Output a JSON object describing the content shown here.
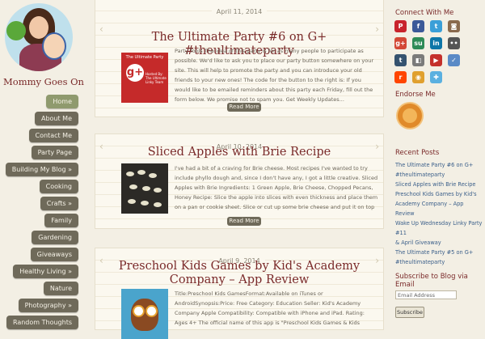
{
  "site": {
    "title": "Mommy Goes On"
  },
  "nav": [
    {
      "label": "Home",
      "active": true
    },
    {
      "label": "About Me"
    },
    {
      "label": "Contact Me"
    },
    {
      "label": "Party Page"
    },
    {
      "label": "Building My Blog »"
    },
    {
      "label": "Cooking"
    },
    {
      "label": "Crafts »"
    },
    {
      "label": "Family"
    },
    {
      "label": "Gardening"
    },
    {
      "label": "Giveaways"
    },
    {
      "label": "Healthy Living »"
    },
    {
      "label": "Nature"
    },
    {
      "label": "Photography »"
    },
    {
      "label": "Random Thoughts"
    }
  ],
  "posts": [
    {
      "date": "April 11, 2014",
      "title": "The Ultimate Party #6 on G+ #theultimateparty",
      "excerpt": "Party Tools The idea of this party is for as many people to participate as possible. We'd like to ask you to place our party button somewhere on your site. This will help to promote the party and you can introduce your old friends to your new ones! The code for the button to the right is:  If you would like to be emailed reminders about this party each Friday, fill out the form below. We promise not to spam you. Get Weekly Updates...",
      "read_more": "Read More",
      "thumb_title": "The Ultimate Party",
      "thumb_text": "Hosted By: The Ultimate Linky Team"
    },
    {
      "date": "April 10, 2014",
      "title": "Sliced Apples with Brie Recipe",
      "excerpt": "I've had a bit of a craving for Brie cheese. Most recipes I've wanted to try include phyllo dough and, since I don't have any, I got a little creative.   Sliced Apples with Brie Ingredients: 1 Green Apple, Brie Cheese, Chopped Pecans, Honey   Recipe: Slice the apple into slices with even thickness and place them on a pan or cookie sheet. Slice or cut up some brie cheese and put it on top of the apple slices. Cook...",
      "read_more": "Read More"
    },
    {
      "date": "April 9, 2014",
      "title": "Preschool Kids Games by Kid's Academy Company – App Review",
      "excerpt": "Title:Preschool Kids GamesFormat:Available on iTunes or AndroidSynopsis:Price: Free Category: Education Seller: Kid's Academy Company Apple Compatibility: Compatible with iPhone and iPad. Rating: Ages 4+ The official name of this app is \"Preschool Kids Games & Kids Puzzles for curious girls and boys ~ Learn interactive ABC Alphabet...",
      "read_more": "Read More"
    }
  ],
  "right": {
    "connect_title": "Connect With Me",
    "social": [
      {
        "icon": "pinterest-icon",
        "glyph": "P",
        "color": "#c8232c"
      },
      {
        "icon": "facebook-icon",
        "glyph": "f",
        "color": "#3b5998"
      },
      {
        "icon": "twitter-icon",
        "glyph": "t",
        "color": "#3a9fd8"
      },
      {
        "icon": "instagram-icon",
        "glyph": "◙",
        "color": "#8a6a4e"
      },
      {
        "icon": "googleplus-icon",
        "glyph": "g+",
        "color": "#d34836"
      },
      {
        "icon": "stumbleupon-icon",
        "glyph": "su",
        "color": "#2e8b57"
      },
      {
        "icon": "linkedin-icon",
        "glyph": "in",
        "color": "#0e76a8"
      },
      {
        "icon": "flickr-icon",
        "glyph": "••",
        "color": "#555555"
      },
      {
        "icon": "tumblr-icon",
        "glyph": "t",
        "color": "#34526f"
      },
      {
        "icon": "delicious-icon",
        "glyph": "◧",
        "color": "#7a7a7a"
      },
      {
        "icon": "youtube-icon",
        "glyph": "▶",
        "color": "#c4302b"
      },
      {
        "icon": "bookmark-icon",
        "glyph": "✓",
        "color": "#5a8ac6"
      },
      {
        "icon": "reddit-icon",
        "glyph": "r",
        "color": "#ff4500"
      },
      {
        "icon": "rss-icon",
        "glyph": "◉",
        "color": "#e0a02e"
      },
      {
        "icon": "plus-icon",
        "glyph": "✚",
        "color": "#5ab0e0"
      }
    ],
    "endorse_title": "Endorse Me",
    "recent_title": "Recent Posts",
    "recent_posts": [
      "The Ultimate Party #6 on G+",
      "#theultimateparty",
      "Sliced Apples with Brie Recipe",
      "Preschool Kids Games by Kid's",
      "Academy Company – App Review",
      "Wake Up Wednesday Linky Party #11",
      "& April Giveaway",
      "The Ultimate Party #5 on G+",
      "#theultimateparty"
    ],
    "subscribe_title": "Subscribe to Blog via Email",
    "email_placeholder": "Email Address",
    "subscribe_label": "Subscribe"
  }
}
